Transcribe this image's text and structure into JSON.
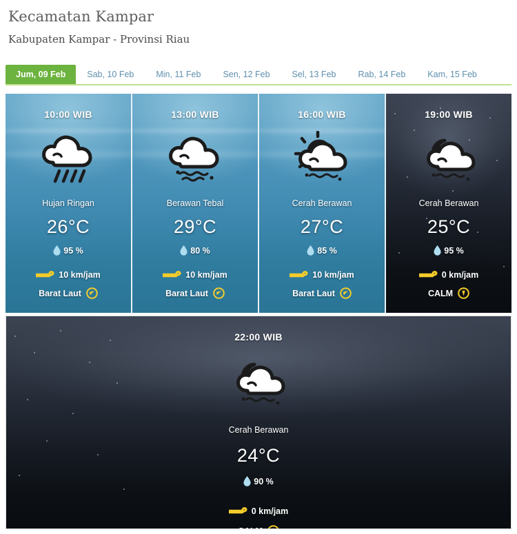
{
  "header": {
    "title": "Kecamatan Kampar",
    "subtitle": "Kabupaten Kampar - Provinsi Riau"
  },
  "colors": {
    "active_tab": "#6cb33f",
    "tab_underline": "#bfe08e",
    "inactive_tab_text": "#5f8fae",
    "title_text": "#5e5e5e",
    "day_card_top": "#60a3c6",
    "day_card_bottom": "#2a7596",
    "night_card_top": "#3c4352",
    "night_card_bottom": "#090c10",
    "accent_yellow": "#f5cc2a",
    "droplet_blue": "#aeddf0"
  },
  "tabs": [
    {
      "label": "Jum, 09 Feb",
      "active": true
    },
    {
      "label": "Sab, 10 Feb",
      "active": false
    },
    {
      "label": "Min, 11 Feb",
      "active": false
    },
    {
      "label": "Sen, 12 Feb",
      "active": false
    },
    {
      "label": "Sel, 13 Feb",
      "active": false
    },
    {
      "label": "Rab, 14 Feb",
      "active": false
    },
    {
      "label": "Kam, 15 Feb",
      "active": false
    }
  ],
  "forecasts": [
    {
      "time": "10:00 WIB",
      "condition": "Hujan Ringan",
      "icon": "rain-cloud-icon",
      "temperature": "26°C",
      "humidity": "95 %",
      "wind_speed": "10 km/jam",
      "wind_direction": "Barat Laut",
      "direction_icon": "compass-arrow-icon",
      "theme": "day"
    },
    {
      "time": "13:00 WIB",
      "condition": "Berawan Tebal",
      "icon": "thick-cloud-icon",
      "temperature": "29°C",
      "humidity": "80 %",
      "wind_speed": "10 km/jam",
      "wind_direction": "Barat Laut",
      "direction_icon": "compass-arrow-icon",
      "theme": "day"
    },
    {
      "time": "16:00 WIB",
      "condition": "Cerah Berawan",
      "icon": "sun-cloud-icon",
      "temperature": "27°C",
      "humidity": "85 %",
      "wind_speed": "10 km/jam",
      "wind_direction": "Barat Laut",
      "direction_icon": "compass-arrow-icon",
      "theme": "day"
    },
    {
      "time": "19:00 WIB",
      "condition": "Cerah Berawan",
      "icon": "moon-cloud-icon",
      "temperature": "25°C",
      "humidity": "95 %",
      "wind_speed": "0 km/jam",
      "wind_direction": "CALM",
      "direction_icon": "calm-compass-icon",
      "theme": "night"
    },
    {
      "time": "22:00 WIB",
      "condition": "Cerah Berawan",
      "icon": "moon-cloud-icon",
      "temperature": "24°C",
      "humidity": "90 %",
      "wind_speed": "0 km/jam",
      "wind_direction": "CALM",
      "direction_icon": "calm-compass-icon",
      "theme": "night"
    }
  ]
}
